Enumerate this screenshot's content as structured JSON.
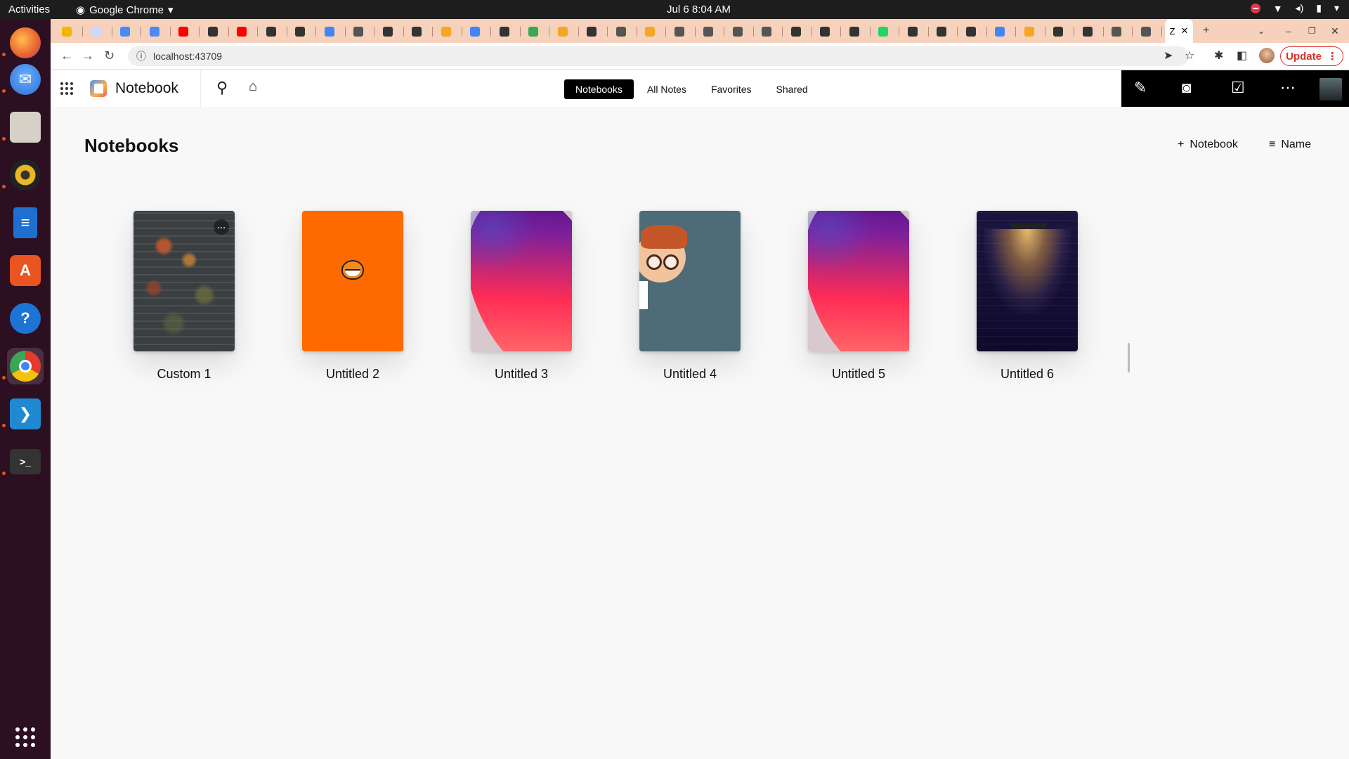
{
  "system": {
    "activities": "Activities",
    "app_name": "Google Chrome",
    "clock": "Jul 6  8:04 AM"
  },
  "dock": {
    "apps": [
      {
        "name": "Firefox",
        "icon": "firefox-icon",
        "color": "#e8622c"
      },
      {
        "name": "Thunderbird",
        "icon": "thunderbird-icon",
        "color": "#2a6fd6"
      },
      {
        "name": "Files",
        "icon": "files-icon",
        "color": "#c9c4bb"
      },
      {
        "name": "Rhythmbox",
        "icon": "rhythmbox-icon",
        "color": "#e9b824"
      },
      {
        "name": "LibreOffice Writer",
        "icon": "writer-icon",
        "color": "#1f6fcf"
      },
      {
        "name": "Ubuntu Software",
        "icon": "software-icon",
        "color": "#e95420"
      },
      {
        "name": "Help",
        "icon": "help-icon",
        "color": "#1d74d4"
      },
      {
        "name": "Google Chrome",
        "icon": "chrome-icon",
        "color": "#e8b817"
      },
      {
        "name": "Visual Studio Code",
        "icon": "vscode-icon",
        "color": "#1f8ad2"
      },
      {
        "name": "Terminal",
        "icon": "terminal-icon",
        "color": "#333333"
      }
    ]
  },
  "browser": {
    "active_tab_title": "Z",
    "url": "localhost:43709",
    "update_label": "Update",
    "new_tab": "+"
  },
  "app": {
    "title": "Notebook",
    "tabs": [
      "Notebooks",
      "All Notes",
      "Favorites",
      "Shared"
    ],
    "selected_tab": "Notebooks",
    "page_title": "Notebooks",
    "add_label": "Notebook",
    "sort_label": "Name",
    "notebooks": [
      {
        "name": "Custom 1"
      },
      {
        "name": "Untitled 2"
      },
      {
        "name": "Untitled 3"
      },
      {
        "name": "Untitled 4"
      },
      {
        "name": "Untitled 5"
      },
      {
        "name": "Untitled 6"
      }
    ]
  },
  "colors": {
    "accent_dark": "#000000",
    "update_red": "#d93025",
    "tabstrip": "#f6d1bc",
    "dock": "#2c0f21"
  }
}
